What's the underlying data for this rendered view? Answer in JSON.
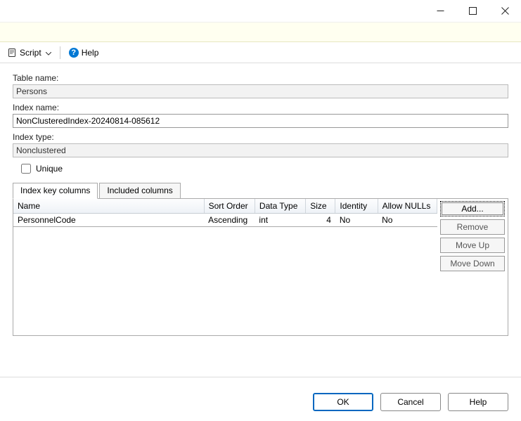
{
  "toolbar": {
    "script_label": "Script",
    "help_label": "Help"
  },
  "fields": {
    "table_name_label": "Table name:",
    "table_name_value": "Persons",
    "index_name_label": "Index name:",
    "index_name_value": "NonClusteredIndex-20240814-085612",
    "index_type_label": "Index type:",
    "index_type_value": "Nonclustered",
    "unique_label": "Unique"
  },
  "tabs": {
    "key_columns": "Index key columns",
    "included_columns": "Included columns"
  },
  "grid": {
    "headers": {
      "name": "Name",
      "sort_order": "Sort Order",
      "data_type": "Data Type",
      "size": "Size",
      "identity": "Identity",
      "allow_nulls": "Allow NULLs"
    },
    "rows": [
      {
        "name": "PersonnelCode",
        "sort_order": "Ascending",
        "data_type": "int",
        "size": "4",
        "identity": "No",
        "allow_nulls": "No"
      }
    ]
  },
  "side_buttons": {
    "add": "Add...",
    "remove": "Remove",
    "move_up": "Move Up",
    "move_down": "Move Down"
  },
  "footer": {
    "ok": "OK",
    "cancel": "Cancel",
    "help": "Help"
  }
}
